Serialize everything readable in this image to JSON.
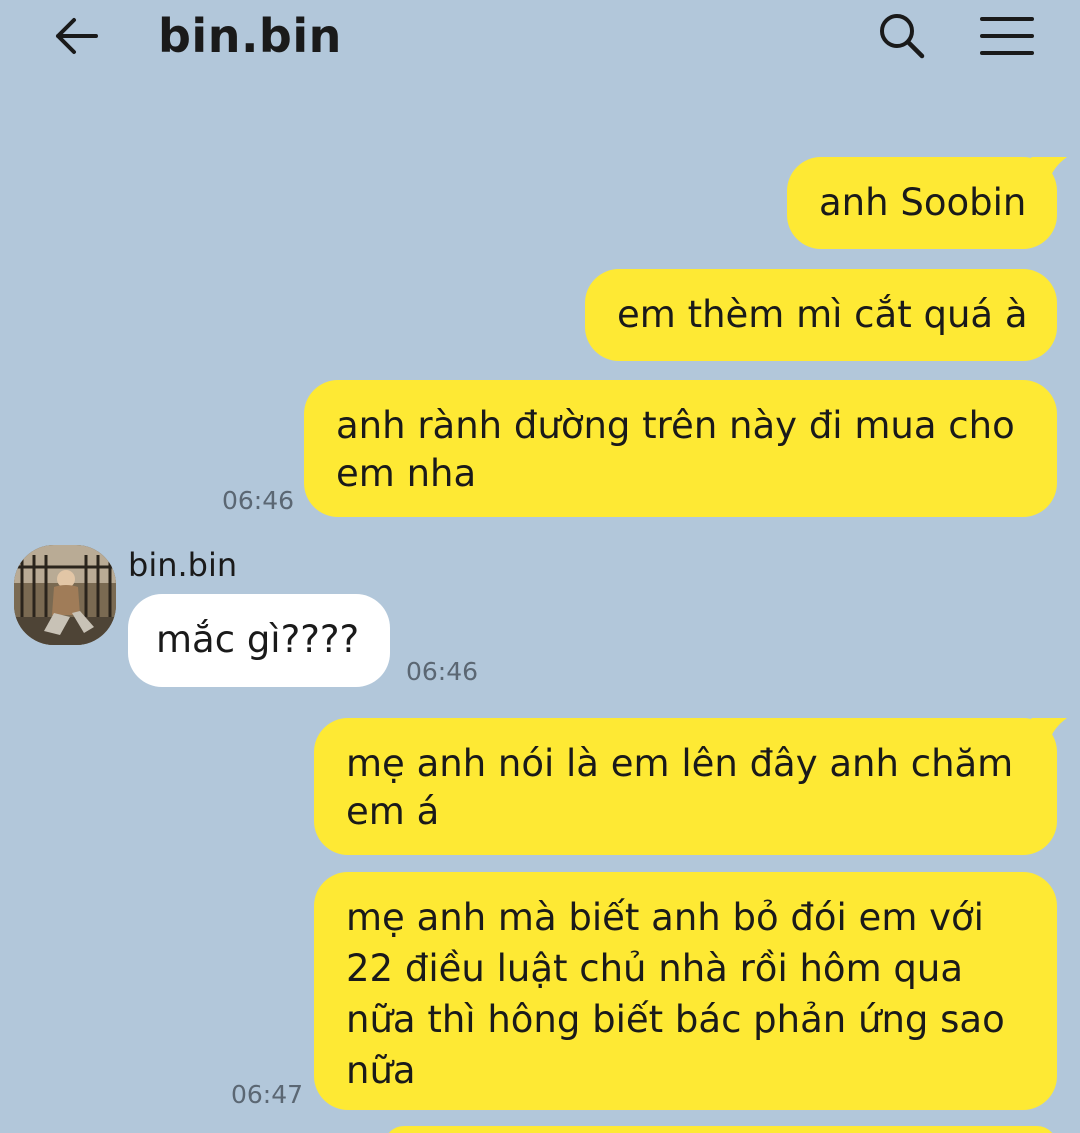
{
  "header": {
    "title": "bin.bin",
    "back_icon": "arrow-left-icon",
    "search_icon": "search-icon",
    "menu_icon": "menu-icon"
  },
  "colors": {
    "background": "#b2c7da",
    "outgoing_bubble": "#fee934",
    "incoming_bubble": "#ffffff"
  },
  "messages": [
    {
      "direction": "out",
      "text": "anh Soobin"
    },
    {
      "direction": "out",
      "text": "em thèm mì cắt quá à"
    },
    {
      "direction": "out",
      "lines": [
        "anh rành đường trên này đi mua cho",
        "em nha"
      ],
      "time": "06:46"
    },
    {
      "direction": "in",
      "sender": "bin.bin",
      "text": "mắc gì????",
      "time": "06:46"
    },
    {
      "direction": "out",
      "lines": [
        "mẹ anh nói là em lên đây anh chăm",
        "em á"
      ]
    },
    {
      "direction": "out",
      "lines": [
        "mẹ anh mà biết anh bỏ đói em với",
        "22 điều luật chủ nhà rồi hôm qua",
        "nữa thì hông biết bác phản ứng sao",
        "nữa"
      ],
      "time": "06:47"
    }
  ]
}
